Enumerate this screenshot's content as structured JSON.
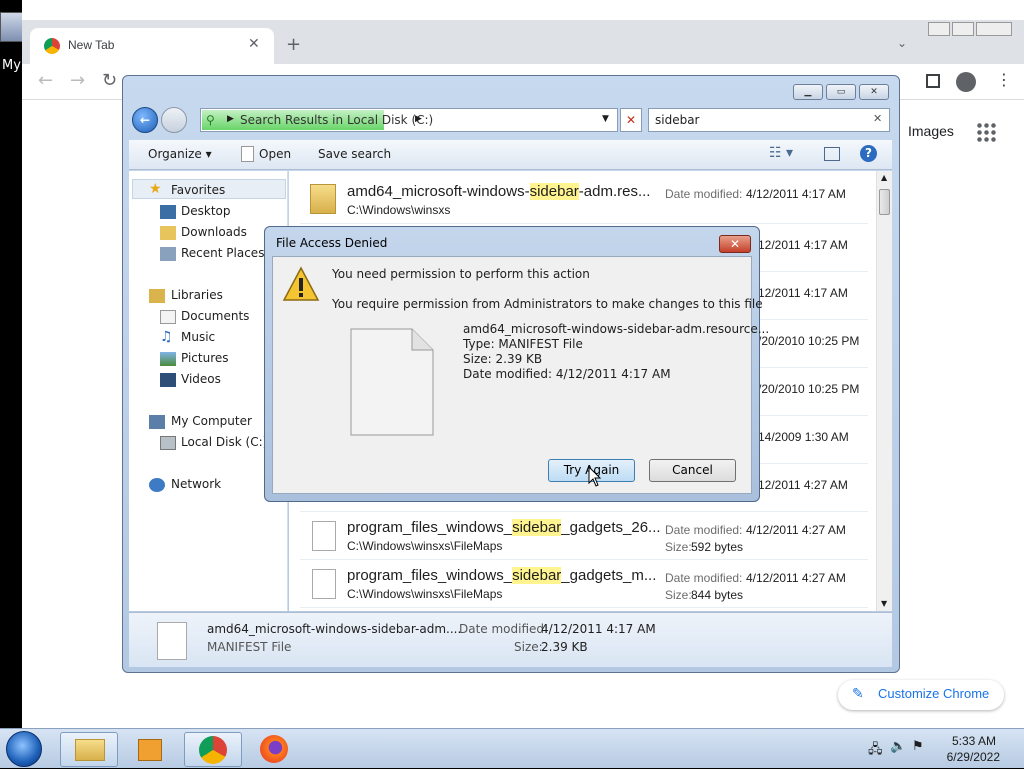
{
  "desktop": {
    "icon_label": "My"
  },
  "chrome": {
    "tab_title": "New Tab",
    "images_link": "Images",
    "customize_label": "Customize Chrome"
  },
  "explorer": {
    "address": "Search Results in Local Disk (C:)",
    "search_value": "sidebar",
    "toolbar": {
      "organize": "Organize",
      "open": "Open",
      "save_search": "Save search"
    },
    "nav": {
      "favorites": "Favorites",
      "desktop": "Desktop",
      "downloads": "Downloads",
      "recent": "Recent Places",
      "libraries": "Libraries",
      "documents": "Documents",
      "music": "Music",
      "pictures": "Pictures",
      "videos": "Videos",
      "computer": "My Computer",
      "local_disk": "Local Disk (C:)",
      "network": "Network"
    },
    "files": [
      {
        "pre": "amd64_microsoft-windows-",
        "hl": "sidebar",
        "post": "-adm.res...",
        "path": "C:\\Windows\\winsxs",
        "date_label": "Date modified:",
        "date": "4/12/2011 4:17 AM"
      },
      {
        "pre": "program_files_windows_",
        "hl": "sidebar",
        "post": "_gadgets_26...",
        "path": "C:\\Windows\\winsxs\\FileMaps",
        "date_label": "Date modified:",
        "date": "4/12/2011 4:27 AM",
        "size_label": "Size:",
        "size": "592 bytes"
      },
      {
        "pre": "program_files_windows_",
        "hl": "sidebar",
        "post": "_gadgets_m...",
        "path": "C:\\Windows\\winsxs\\FileMaps",
        "date_label": "Date modified:",
        "date": "4/12/2011 4:27 AM",
        "size_label": "Size:",
        "size": "844 bytes"
      }
    ],
    "hidden_dates": [
      "12/2011 4:17 AM",
      "12/2011 4:17 AM",
      "/20/2010 10:25 PM",
      "/20/2010 10:25 PM",
      "14/2009 1:30 AM",
      "12/2011 4:27 AM"
    ],
    "details": {
      "name": "amd64_microsoft-windows-sidebar-adm....",
      "type": "MANIFEST File",
      "date_label": "Date modified:",
      "date": "4/12/2011 4:17 AM",
      "size_label": "Size:",
      "size": "2.39 KB"
    }
  },
  "dialog": {
    "title": "File Access Denied",
    "close": "✕",
    "message1": "You need permission to perform this action",
    "message2": "You require permission from Administrators to make changes to this file",
    "file_name": "amd64_microsoft-windows-sidebar-adm.resource...",
    "file_type": "Type: MANIFEST File",
    "file_size": "Size: 2.39 KB",
    "file_date": "Date modified: 4/12/2011 4:17 AM",
    "try_again": "Try Again",
    "cancel": "Cancel"
  },
  "taskbar": {
    "time": "5:33 AM",
    "date": "6/29/2022"
  }
}
